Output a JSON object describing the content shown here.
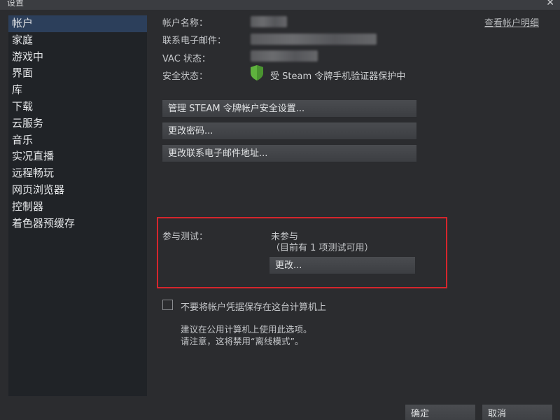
{
  "window": {
    "title": "设置"
  },
  "sidebar": {
    "items": [
      {
        "label": "帐户"
      },
      {
        "label": "家庭"
      },
      {
        "label": "游戏中"
      },
      {
        "label": "界面"
      },
      {
        "label": "库"
      },
      {
        "label": "下载"
      },
      {
        "label": "云服务"
      },
      {
        "label": "音乐"
      },
      {
        "label": "实况直播"
      },
      {
        "label": "远程畅玩"
      },
      {
        "label": "网页浏览器"
      },
      {
        "label": "控制器"
      },
      {
        "label": "着色器预缓存"
      }
    ]
  },
  "account": {
    "name_label": "帐户名称：",
    "email_label": "联系电子邮件：",
    "vac_label": "VAC 状态：",
    "security_label": "安全状态：",
    "security_status": "受 Steam 令牌手机验证器保护中",
    "view_details_link": "查看帐户明细",
    "shield_color": "#5fb33e"
  },
  "buttons": {
    "manage_guard": "管理 STEAM 令牌帐户安全设置...",
    "change_password": "更改密码...",
    "change_email": "更改联系电子邮件地址..."
  },
  "beta": {
    "label": "参与测试：",
    "status": "未参与",
    "available": "（目前有 1 项测试可用）",
    "change_button": "更改...",
    "highlight_color": "#d6262c"
  },
  "credentials": {
    "checkbox_label": "不要将帐户凭据保存在这台计算机上",
    "note_line1": "建议在公用计算机上使用此选项。",
    "note_line2": "请注意，这将禁用“离线模式”。"
  },
  "footer": {
    "ok": "确定",
    "cancel": "取消"
  }
}
